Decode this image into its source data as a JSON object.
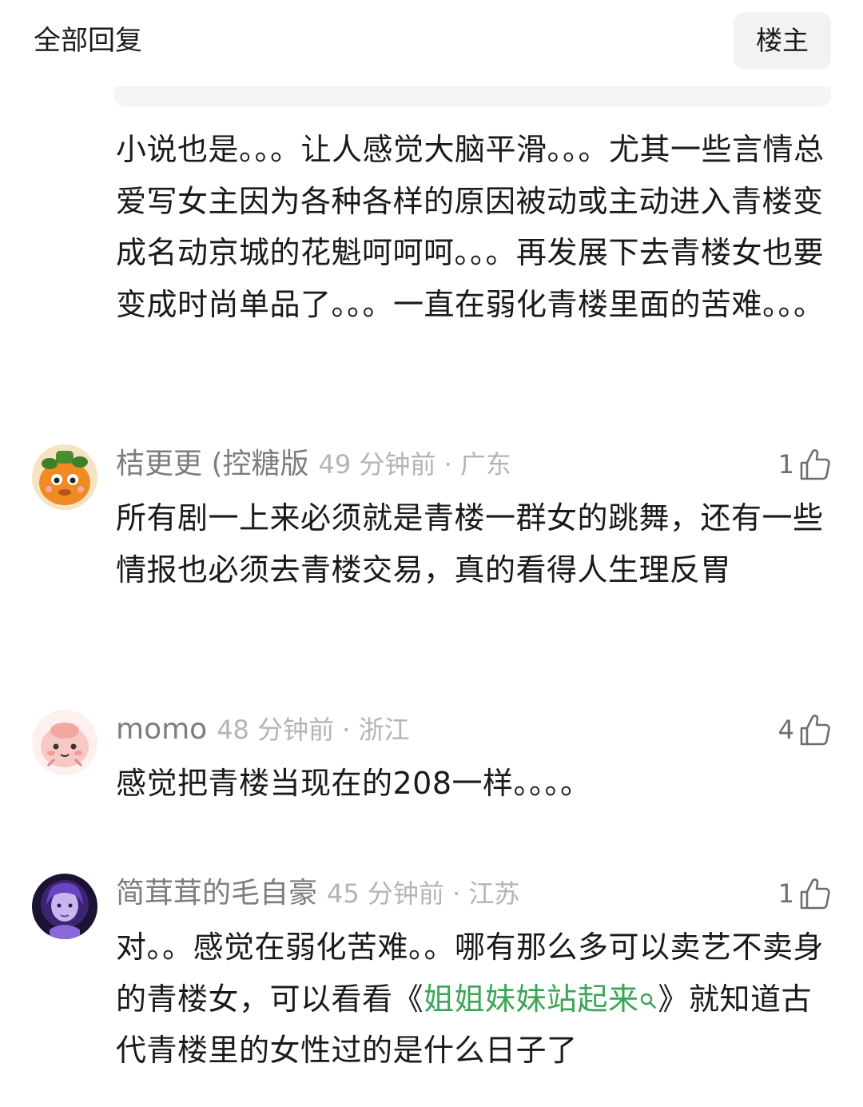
{
  "header": {
    "title": "全部回复",
    "filter_label": "楼主"
  },
  "first_comment": {
    "text": "小说也是。。。让人感觉大脑平滑。。。尤其一些言情总爱写女主因为各种各样的原因被动或主动进入青楼变成名动京城的花魁呵呵呵。。。再发展下去青楼女也要变成时尚单品了。。。一直在弱化青楼里面的苦难。。。"
  },
  "comments": [
    {
      "username": "桔更更 (控糖版",
      "time_location": "49 分钟前 · 广东",
      "likes": "1",
      "text": "所有剧一上来必须就是青楼一群女的跳舞，还有一些情报也必须去青楼交易，真的看得人生理反胃"
    },
    {
      "username": "momo",
      "time_location": "48 分钟前 · 浙江",
      "likes": "4",
      "text": "感觉把青楼当现在的208一样。。。。"
    },
    {
      "username": "简茸茸的毛自豪",
      "time_location": "45 分钟前 · 江苏",
      "likes": "1",
      "text_before": "对。。感觉在弱化苦难。。哪有那么多可以卖艺不卖身的青楼女，可以看看《",
      "link_text": "姐姐妹妹站起来",
      "text_after": "》就知道古代青楼里的女性过的是什么日子了"
    }
  ],
  "colors": {
    "link": "#3aa656",
    "username": "#7d7d7d",
    "meta": "#b4b4b4"
  },
  "icons": {
    "like": "thumbs-up-icon",
    "link_search": "search-icon"
  }
}
